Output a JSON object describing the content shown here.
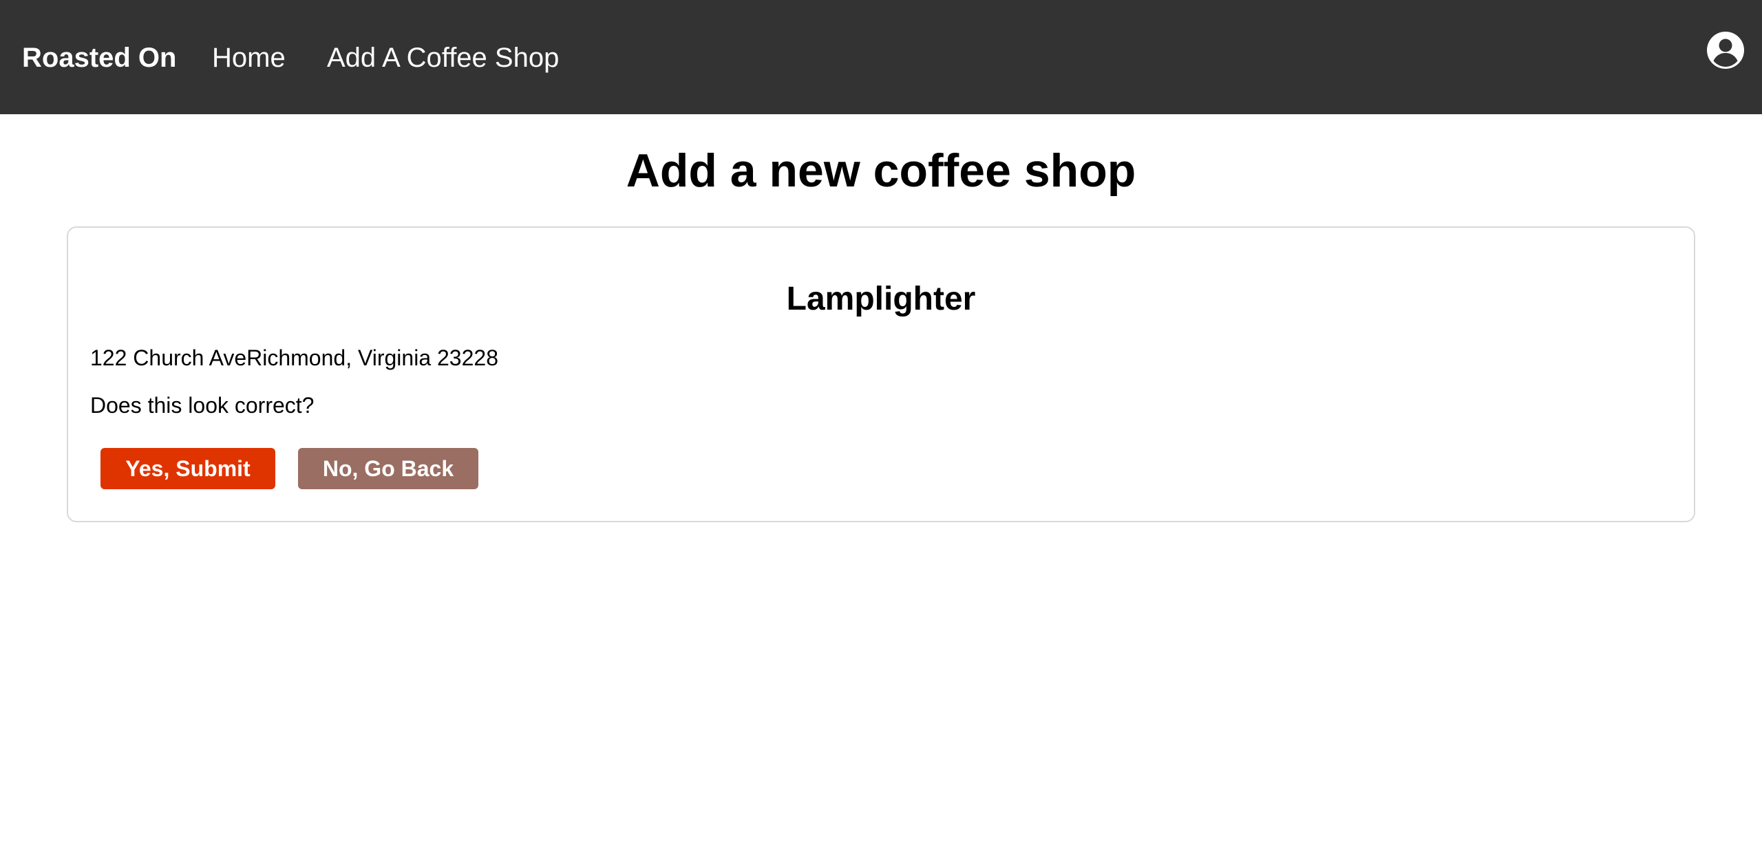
{
  "header": {
    "brand": "Roasted On",
    "nav": {
      "home": "Home",
      "add_shop": "Add A Coffee Shop"
    },
    "account_icon": "account-circle-icon"
  },
  "main": {
    "title": "Add a new coffee shop"
  },
  "card": {
    "shop_name": "Lamplighter",
    "address": "122 Church AveRichmond, Virginia 23228",
    "question": "Does this look correct?",
    "submit_label": "Yes, Submit",
    "back_label": "No, Go Back"
  },
  "colors": {
    "navbar": "#333333",
    "submit_button": "#E03400",
    "back_button": "#9A6E62",
    "card_border": "#D9D9D9"
  }
}
